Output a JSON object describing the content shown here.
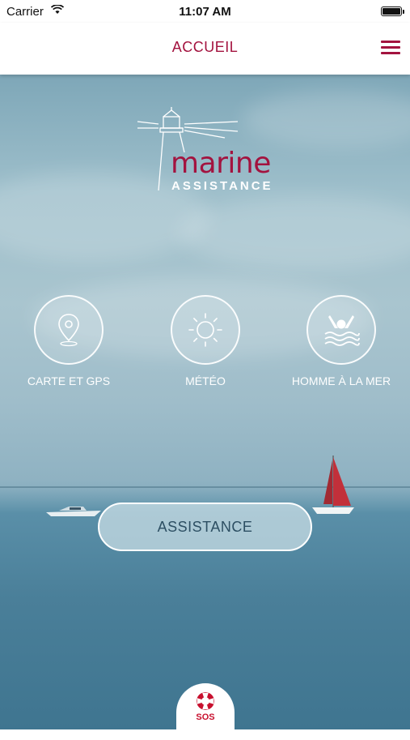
{
  "status_bar": {
    "carrier": "Carrier",
    "time": "11:07 AM"
  },
  "nav": {
    "title": "ACCUEIL"
  },
  "logo": {
    "word": "marine",
    "subtitle": "ASSISTANCE"
  },
  "features": [
    {
      "label": "CARTE ET GPS",
      "icon": "map-pin-icon"
    },
    {
      "label": "MÉTÉO",
      "icon": "sun-icon"
    },
    {
      "label": "HOMME À LA MER",
      "icon": "man-overboard-icon"
    }
  ],
  "assistance_button": {
    "label": "ASSISTANCE"
  },
  "sos": {
    "label": "SOS",
    "icon": "lifebuoy-icon"
  },
  "colors": {
    "brand": "#a3133f",
    "sos": "#c8102e",
    "button_text": "#2d4f63"
  }
}
